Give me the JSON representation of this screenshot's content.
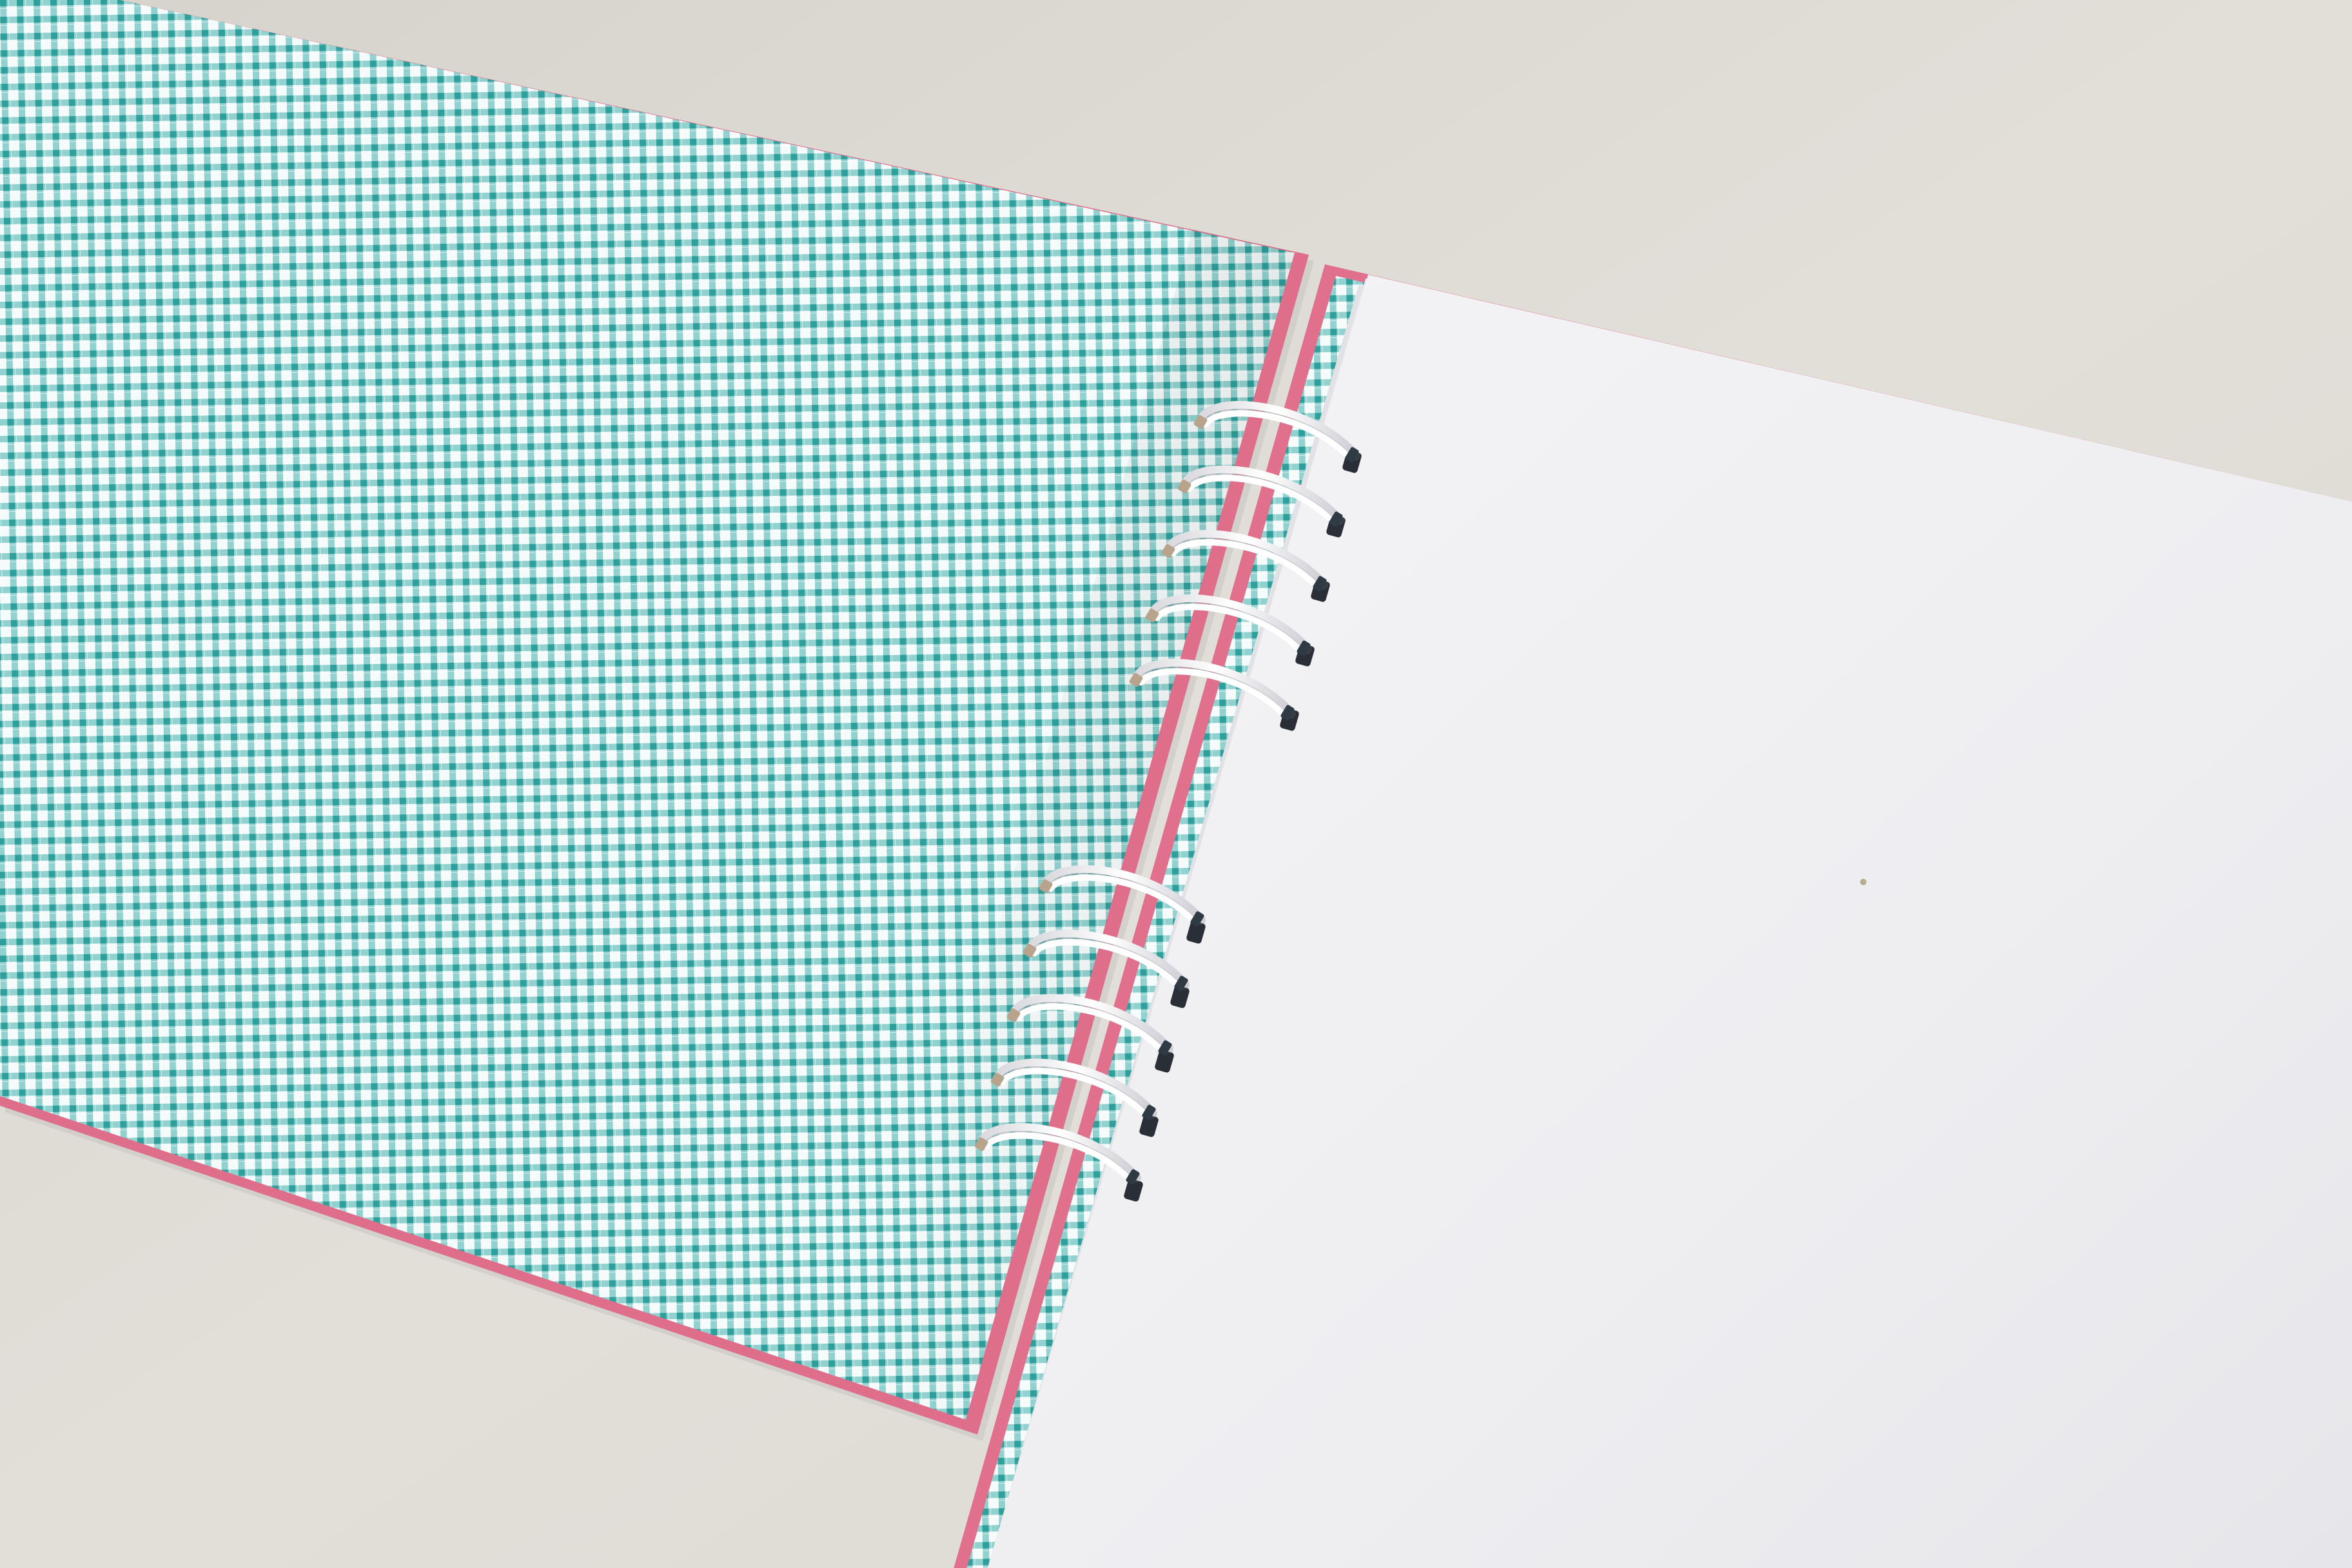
{
  "scene": {
    "subject": "spiral-notebook",
    "colors": {
      "background": "#dedbd5",
      "gingham_teal": "#3fb0ad",
      "gingham_white": "#f4fbfa",
      "cover_pink": "#e0708c",
      "page_white": "#f1f1f3",
      "wire_white": "#fbfbfc"
    },
    "binding": {
      "upper_group_rings": 5,
      "lower_group_rings": 5
    }
  }
}
